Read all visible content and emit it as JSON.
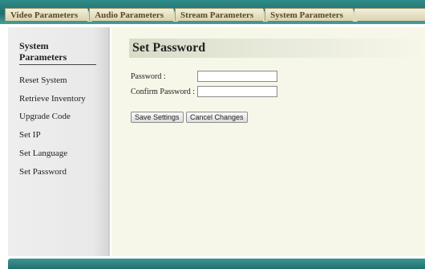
{
  "tabs": [
    {
      "label": "Video Parameters"
    },
    {
      "label": "Audio Parameters"
    },
    {
      "label": "Stream Parameters"
    },
    {
      "label": "System Parameters"
    }
  ],
  "sidebar": {
    "title": "System Parameters",
    "items": [
      {
        "label": "Reset System"
      },
      {
        "label": "Retrieve Inventory"
      },
      {
        "label": "Upgrade Code"
      },
      {
        "label": "Set IP"
      },
      {
        "label": "Set Language"
      },
      {
        "label": "Set Password"
      }
    ]
  },
  "main": {
    "title": "Set Password",
    "fields": {
      "password_label": "Password :",
      "password_value": "",
      "confirm_label": "Confirm Password :",
      "confirm_value": ""
    },
    "buttons": {
      "save": "Save Settings",
      "cancel": "Cancel Changes"
    }
  },
  "colors": {
    "header_bar": "#1f6f6e",
    "tab_text": "#5c4a24",
    "content_bg": "#f6f7e9"
  }
}
